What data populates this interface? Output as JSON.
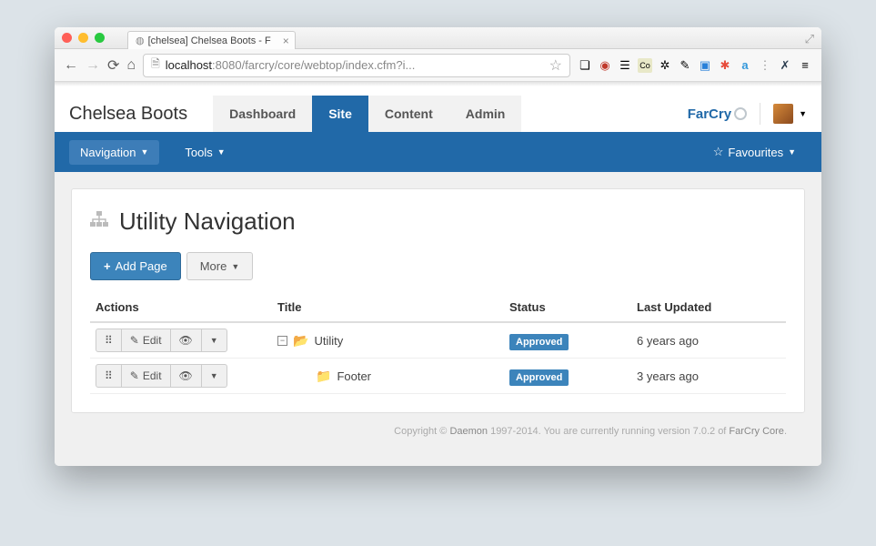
{
  "browser": {
    "tabTitle": "[chelsea] Chelsea Boots - F",
    "urlHost": "localhost",
    "urlPath": ":8080/farcry/core/webtop/index.cfm?i..."
  },
  "header": {
    "brand": "Chelsea Boots",
    "tabs": [
      "Dashboard",
      "Site",
      "Content",
      "Admin"
    ],
    "activeTab": 1,
    "logoText": "FarCry"
  },
  "subnav": {
    "items": [
      "Navigation",
      "Tools"
    ],
    "activeItem": 0,
    "favourites": "Favourites"
  },
  "page": {
    "title": "Utility Navigation",
    "addPage": "Add Page",
    "more": "More"
  },
  "table": {
    "headers": {
      "actions": "Actions",
      "title": "Title",
      "status": "Status",
      "updated": "Last Updated"
    },
    "editLabel": "Edit",
    "rows": [
      {
        "title": "Utility",
        "status": "Approved",
        "updated": "6 years ago",
        "indent": 0,
        "expanded": true
      },
      {
        "title": "Footer",
        "status": "Approved",
        "updated": "3 years ago",
        "indent": 1,
        "expanded": false
      }
    ]
  },
  "footer": {
    "pre": "Copyright © ",
    "daemon": "Daemon",
    "mid": " 1997-2014. You are currently running version 7.0.2 of ",
    "core": "FarCry Core",
    "suf": "."
  }
}
